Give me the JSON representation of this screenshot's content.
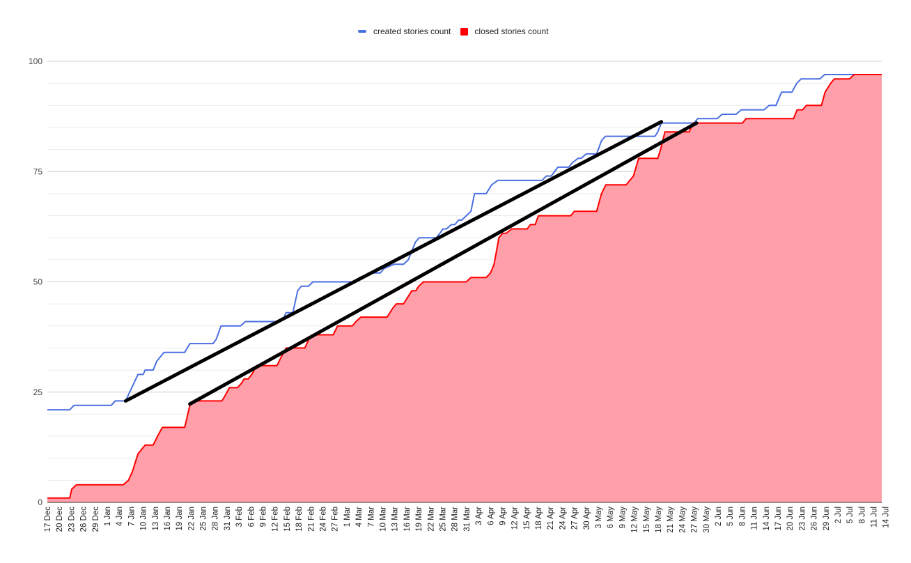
{
  "chart_data": {
    "type": "area",
    "title": "",
    "xlabel": "",
    "ylabel": "",
    "ylim": [
      0,
      100
    ],
    "y_ticks": [
      "0",
      "25",
      "50",
      "75",
      "100"
    ],
    "y_major_step": 25,
    "y_minor_step": 5,
    "grid": true,
    "legend_position": "top-center",
    "x_start_date": "17 Dec",
    "x_total_days": 209,
    "x_tick_labels": [
      "17 Dec",
      "20 Dec",
      "23 Dec",
      "26 Dec",
      "29 Dec",
      "1 Jan",
      "4 Jan",
      "7 Jan",
      "10 Jan",
      "13 Jan",
      "16 Jan",
      "19 Jan",
      "22 Jan",
      "25 Jan",
      "28 Jan",
      "31 Jan",
      "3 Feb",
      "6 Feb",
      "9 Feb",
      "12 Feb",
      "15 Feb",
      "18 Feb",
      "21 Feb",
      "24 Feb",
      "27 Feb",
      "1 Mar",
      "4 Mar",
      "7 Mar",
      "10 Mar",
      "13 Mar",
      "16 Mar",
      "19 Mar",
      "22 Mar",
      "25 Mar",
      "28 Mar",
      "31 Mar",
      "3 Apr",
      "6 Apr",
      "9 Apr",
      "12 Apr",
      "15 Apr",
      "18 Apr",
      "21 Apr",
      "24 Apr",
      "27 Apr",
      "30 Apr",
      "3 May",
      "6 May",
      "9 May",
      "12 May",
      "15 May",
      "18 May",
      "21 May",
      "24 May",
      "27 May",
      "30 May",
      "2 Jun",
      "5 Jun",
      "8 Jun",
      "11 Jun",
      "14 Jun",
      "17 Jun",
      "20 Jun",
      "23 Jun",
      "26 Jun",
      "29 Jun",
      "2 Jul",
      "5 Jul",
      "8 Jul",
      "11 Jul",
      "14 Jul"
    ],
    "series": [
      {
        "name": "created stories count",
        "color": "#4a6fe3",
        "style": "line",
        "points_day_value": [
          [
            0,
            21
          ],
          [
            5.6,
            21
          ],
          [
            6.7,
            22
          ],
          [
            16,
            22
          ],
          [
            17,
            23
          ],
          [
            19.6,
            23
          ],
          [
            22.7,
            29
          ],
          [
            24,
            29
          ],
          [
            24.5,
            30
          ],
          [
            26.5,
            30
          ],
          [
            27.4,
            32
          ],
          [
            28.3,
            33
          ],
          [
            29.2,
            34
          ],
          [
            34.4,
            34
          ],
          [
            35.7,
            36
          ],
          [
            41.5,
            36
          ],
          [
            42.3,
            37
          ],
          [
            43.5,
            40
          ],
          [
            48.4,
            40
          ],
          [
            49.6,
            41
          ],
          [
            58,
            41
          ],
          [
            59.3,
            42
          ],
          [
            59.8,
            43
          ],
          [
            61.5,
            43
          ],
          [
            62.7,
            48
          ],
          [
            63.6,
            49
          ],
          [
            65.4,
            49
          ],
          [
            66.5,
            50
          ],
          [
            77.3,
            50
          ],
          [
            78.2,
            51
          ],
          [
            81.6,
            52
          ],
          [
            83.4,
            52
          ],
          [
            84.3,
            53
          ],
          [
            86.9,
            54
          ],
          [
            89.2,
            54
          ],
          [
            90.4,
            55
          ],
          [
            92.2,
            59
          ],
          [
            93.1,
            60
          ],
          [
            97.4,
            60
          ],
          [
            98.3,
            61
          ],
          [
            99.1,
            62
          ],
          [
            100,
            62
          ],
          [
            101.2,
            63
          ],
          [
            102.1,
            63
          ],
          [
            103,
            64
          ],
          [
            103.8,
            64
          ],
          [
            106.1,
            66
          ],
          [
            107,
            70
          ],
          [
            109.9,
            70
          ],
          [
            111.3,
            72
          ],
          [
            112.8,
            73
          ],
          [
            123.9,
            73
          ],
          [
            125,
            74
          ],
          [
            126.2,
            74
          ],
          [
            127.9,
            76
          ],
          [
            130.6,
            76
          ],
          [
            131.5,
            77
          ],
          [
            132.9,
            78
          ],
          [
            133.7,
            78
          ],
          [
            135,
            79
          ],
          [
            137.6,
            79
          ],
          [
            138.8,
            82
          ],
          [
            139.8,
            83
          ],
          [
            146.3,
            83
          ],
          [
            152.2,
            83
          ],
          [
            152.9,
            84
          ],
          [
            153.8,
            86
          ],
          [
            162,
            86
          ],
          [
            162.9,
            87
          ],
          [
            167.8,
            87
          ],
          [
            169,
            88
          ],
          [
            172.5,
            88
          ],
          [
            173.8,
            89
          ],
          [
            179.5,
            89
          ],
          [
            180.8,
            90
          ],
          [
            182.5,
            90
          ],
          [
            183.9,
            93
          ],
          [
            186.5,
            93
          ],
          [
            187.7,
            95
          ],
          [
            188.8,
            96
          ],
          [
            193.5,
            96
          ],
          [
            194.7,
            97
          ],
          [
            209,
            97
          ]
        ]
      },
      {
        "name": "closed stories count",
        "color": "#ff0000",
        "fill": "#ff9fa9",
        "style": "area",
        "points_day_value": [
          [
            0,
            1
          ],
          [
            5.6,
            1
          ],
          [
            6.1,
            3
          ],
          [
            7.3,
            4
          ],
          [
            19,
            4
          ],
          [
            20.3,
            5
          ],
          [
            21.3,
            7
          ],
          [
            22.7,
            11
          ],
          [
            23.6,
            12
          ],
          [
            24.5,
            13
          ],
          [
            26.5,
            13
          ],
          [
            27.6,
            15
          ],
          [
            28.8,
            17
          ],
          [
            34.4,
            17
          ],
          [
            35.7,
            22
          ],
          [
            36.7,
            23
          ],
          [
            43.7,
            23
          ],
          [
            44.4,
            24
          ],
          [
            45.6,
            26
          ],
          [
            47.6,
            26
          ],
          [
            48.6,
            27
          ],
          [
            49.3,
            28
          ],
          [
            50.3,
            28
          ],
          [
            51.2,
            29
          ],
          [
            52.4,
            31
          ],
          [
            57.5,
            31
          ],
          [
            58.6,
            33
          ],
          [
            59.8,
            35
          ],
          [
            64.5,
            35
          ],
          [
            65.5,
            37
          ],
          [
            66.8,
            38
          ],
          [
            71.6,
            38
          ],
          [
            72.7,
            40
          ],
          [
            76.4,
            40
          ],
          [
            77.3,
            41
          ],
          [
            78.5,
            42
          ],
          [
            85.1,
            42
          ],
          [
            86.5,
            44
          ],
          [
            87.4,
            45
          ],
          [
            89.2,
            45
          ],
          [
            89.9,
            46
          ],
          [
            91.3,
            48
          ],
          [
            92.3,
            48
          ],
          [
            93,
            49
          ],
          [
            94.2,
            50
          ],
          [
            104.9,
            50
          ],
          [
            106.1,
            51
          ],
          [
            109.9,
            51
          ],
          [
            111,
            52
          ],
          [
            111.9,
            54
          ],
          [
            113.1,
            60
          ],
          [
            114,
            61
          ],
          [
            114.9,
            61
          ],
          [
            116.3,
            62
          ],
          [
            120.2,
            62
          ],
          [
            121,
            63
          ],
          [
            122.2,
            63
          ],
          [
            123,
            65
          ],
          [
            131.1,
            65
          ],
          [
            132,
            66
          ],
          [
            137.6,
            66
          ],
          [
            138.8,
            70
          ],
          [
            139.9,
            72
          ],
          [
            145,
            72
          ],
          [
            146.8,
            74
          ],
          [
            148.1,
            78
          ],
          [
            152.9,
            78
          ],
          [
            153.6,
            80
          ],
          [
            154.7,
            84
          ],
          [
            158.5,
            84
          ],
          [
            159.4,
            84
          ],
          [
            160.8,
            84
          ],
          [
            161.7,
            86
          ],
          [
            174.1,
            86
          ],
          [
            175,
            87
          ],
          [
            186.9,
            87
          ],
          [
            187.8,
            89
          ],
          [
            189.2,
            89
          ],
          [
            190.1,
            90
          ],
          [
            193.9,
            90
          ],
          [
            194.8,
            93
          ],
          [
            196.2,
            95
          ],
          [
            197.1,
            96
          ],
          [
            200.9,
            96
          ],
          [
            202.1,
            97
          ],
          [
            209,
            97
          ]
        ]
      }
    ],
    "annotations": [
      {
        "type": "trend-line",
        "color": "#000000",
        "from_day_value": [
          19.6,
          23
        ],
        "to_day_value": [
          153.8,
          86.3
        ]
      },
      {
        "type": "trend-line",
        "color": "#000000",
        "from_day_value": [
          35.7,
          22.3
        ],
        "to_day_value": [
          162.6,
          86
        ]
      }
    ]
  },
  "legend": {
    "items": [
      {
        "label": "created stories count",
        "color": "#4a6fe3"
      },
      {
        "label": "closed stories count",
        "color": "#ff0000"
      }
    ]
  }
}
